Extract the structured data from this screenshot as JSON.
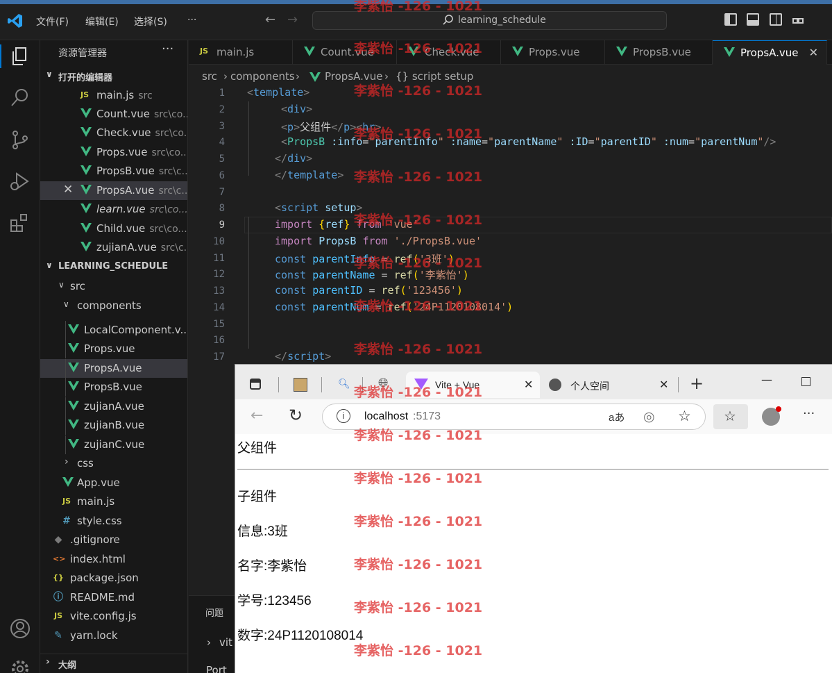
{
  "titlebar": {
    "menus": [
      "文件(F)",
      "编辑(E)",
      "选择(S)",
      "···"
    ],
    "search": "learning_schedule"
  },
  "sidebar": {
    "title": "资源管理器",
    "more": "···",
    "open_editors_label": "打开的编辑器",
    "open_editors": [
      {
        "name": "main.js",
        "path": "src",
        "icon": "JS"
      },
      {
        "name": "Count.vue",
        "path": "src\\co...",
        "icon": "vue"
      },
      {
        "name": "Check.vue",
        "path": "src\\co...",
        "icon": "vue"
      },
      {
        "name": "Props.vue",
        "path": "src\\co...",
        "icon": "vue"
      },
      {
        "name": "PropsB.vue",
        "path": "src\\c...",
        "icon": "vue"
      },
      {
        "name": "PropsA.vue",
        "path": "src\\c...",
        "icon": "vue"
      },
      {
        "name": "learn.vue",
        "path": "src\\co...",
        "icon": "vue"
      },
      {
        "name": "Child.vue",
        "path": "src\\co...",
        "icon": "vue"
      },
      {
        "name": "zujianA.vue",
        "path": "src\\c...",
        "icon": "vue"
      }
    ],
    "project_label": "LEARNING_SCHEDULE",
    "tree": {
      "src": "src",
      "components": "components",
      "component_files": [
        "LocalComponent.v...",
        "Props.vue",
        "PropsA.vue",
        "PropsB.vue",
        "zujianA.vue",
        "zujianB.vue",
        "zujianC.vue"
      ],
      "css": "css",
      "app": "App.vue",
      "mainjs": "main.js",
      "stylecss": "style.css",
      "root_files": [
        ".gitignore",
        "index.html",
        "package.json",
        "README.md",
        "vite.config.js",
        "yarn.lock"
      ]
    },
    "outline_label": "大纲"
  },
  "tabs": [
    "main.js",
    "Count.vue",
    "Check.vue",
    "Props.vue",
    "PropsB.vue",
    "PropsA.vue"
  ],
  "breadcrumb": [
    "src",
    "components",
    "PropsA.vue",
    "{} script setup"
  ],
  "line_numbers": [
    "1",
    "2",
    "3",
    "4",
    "5",
    "6",
    "7",
    "8",
    "9",
    "10",
    "11",
    "12",
    "13",
    "14",
    "15",
    "16",
    "17"
  ],
  "code": {
    "l3_text": "父组件",
    "l11_val": "'3班'",
    "l12_val": "'李紫怡'",
    "l13_val": "'123456'",
    "l14_val": "'24P1120108014'"
  },
  "panel": {
    "problems": "问题",
    "row1": "vit",
    "row2": "Port"
  },
  "browser": {
    "tab_active": "Vite + Vue",
    "tab_other": "个人空间",
    "url_host": "localhost",
    "url_port": ":5173",
    "page": {
      "parent": "父组件",
      "child": "子组件",
      "info": "信息:3班",
      "name": "名字:李紫怡",
      "id": "学号:123456",
      "num": "数字:24P1120108014"
    }
  },
  "watermark": "李紫怡 -126 - 1021"
}
